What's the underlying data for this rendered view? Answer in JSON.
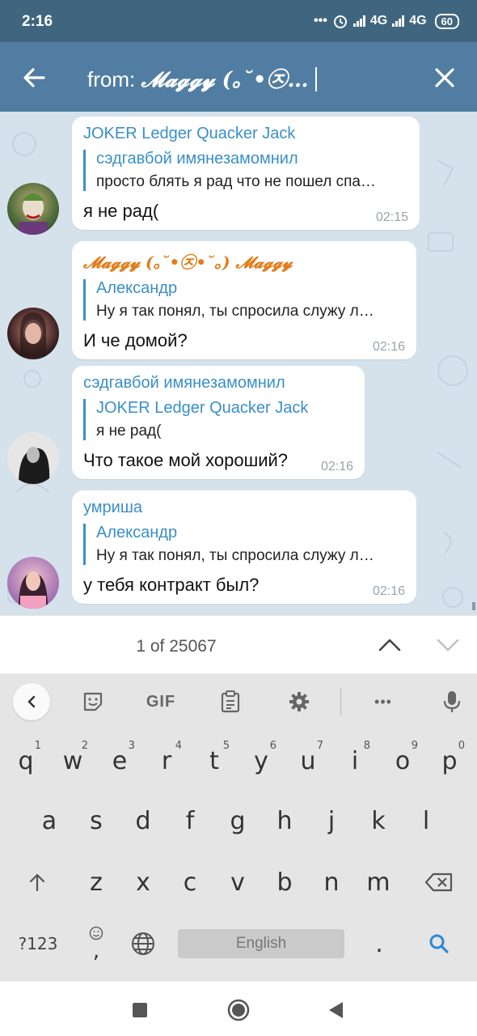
{
  "status_bar": {
    "time": "2:16",
    "dots": "•••",
    "network1": "4G",
    "network2": "4G",
    "battery": "60"
  },
  "search": {
    "prefix": "from: ",
    "name": "𝓜𝓪𝓰𝓰𝔂 (｡˘•㉨…"
  },
  "messages": [
    {
      "sender": "JOKER Ledger Quacker Jack",
      "reply_name": "сэдгавбой имянезамомнил",
      "reply_text": "просто блять я рад что не пошел спа…",
      "text": "я не рад(",
      "time": "02:15"
    },
    {
      "sender": "𝓜𝓪𝓰𝓰𝔂 (｡˘•㉨•˘｡) 𝓜𝓪𝓰𝓰𝔂",
      "reply_name": "Александр",
      "reply_text": "Ну я так понял, ты спросила служу л…",
      "text": "И че домой?",
      "time": "02:16"
    },
    {
      "sender": "сэдгавбой имянезамомнил",
      "reply_name": "JOKER Ledger Quacker Jack",
      "reply_text": "я не рад(",
      "text": "Что такое мой хороший?",
      "time": "02:16"
    },
    {
      "sender": "умриша",
      "reply_name": "Александр",
      "reply_text": "Ну я так понял, ты спросила служу л…",
      "text": "у тебя контракт был?",
      "time": "02:16"
    }
  ],
  "results": {
    "count": "1 of 25067"
  },
  "keyboard": {
    "toolbar": {
      "gif": "GIF",
      "more": "•••"
    },
    "row1": [
      {
        "k": "q",
        "n": "1"
      },
      {
        "k": "w",
        "n": "2"
      },
      {
        "k": "e",
        "n": "3"
      },
      {
        "k": "r",
        "n": "4"
      },
      {
        "k": "t",
        "n": "5"
      },
      {
        "k": "y",
        "n": "6"
      },
      {
        "k": "u",
        "n": "7"
      },
      {
        "k": "i",
        "n": "8"
      },
      {
        "k": "o",
        "n": "9"
      },
      {
        "k": "p",
        "n": "0"
      }
    ],
    "row2": [
      "a",
      "s",
      "d",
      "f",
      "g",
      "h",
      "j",
      "k",
      "l"
    ],
    "row3": [
      "z",
      "x",
      "c",
      "v",
      "b",
      "n",
      "m"
    ],
    "sym_label": "?123",
    "comma": ",",
    "space_label": "English",
    "period": "."
  },
  "colors": {
    "header": "#517da2",
    "status": "#40667f",
    "link": "#3a8fc9",
    "chat_bg": "#d5e2ec",
    "orange_name": "#e07d1a"
  }
}
